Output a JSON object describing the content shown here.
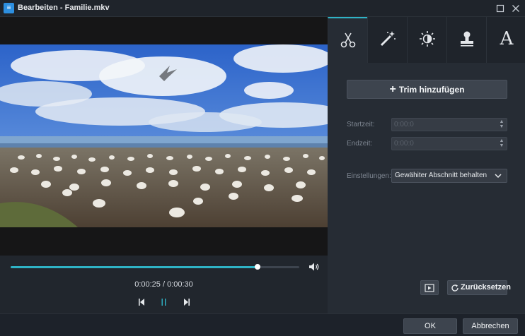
{
  "window": {
    "title": "Bearbeiten - Familie.mkv",
    "icons": {
      "app": "app-logo-icon",
      "maximize": "maximize-icon",
      "close": "close-icon"
    }
  },
  "player": {
    "time_display": "0:00:25 / 0:00:30",
    "progress_fraction": 0.856,
    "icons": {
      "volume": "volume-icon",
      "prev_frame": "previous-frame-icon",
      "pause": "pause-icon",
      "next_frame": "next-frame-icon"
    }
  },
  "tabs": [
    {
      "icon": "scissors-icon",
      "active": true
    },
    {
      "icon": "magic-wand-icon",
      "active": false
    },
    {
      "icon": "brightness-icon",
      "active": false
    },
    {
      "icon": "stamp-icon",
      "active": false
    },
    {
      "icon": "text-icon",
      "label": "A",
      "active": false
    }
  ],
  "trim": {
    "add_label": "Trim hinzufügen",
    "start_label": "Startzeit:",
    "start_value": "0:00:0",
    "end_label": "Endzeit:",
    "end_value": "0:00:0",
    "settings_label": "Einstellungen:",
    "settings_value": "Gewähiter Abschnitt behalten",
    "reset_label": "Zurücksetzen"
  },
  "footer": {
    "ok_label": "OK",
    "cancel_label": "Abbrechen"
  },
  "colors": {
    "accent": "#2fb3c6",
    "panel": "#262c34",
    "button": "#3d444e"
  }
}
